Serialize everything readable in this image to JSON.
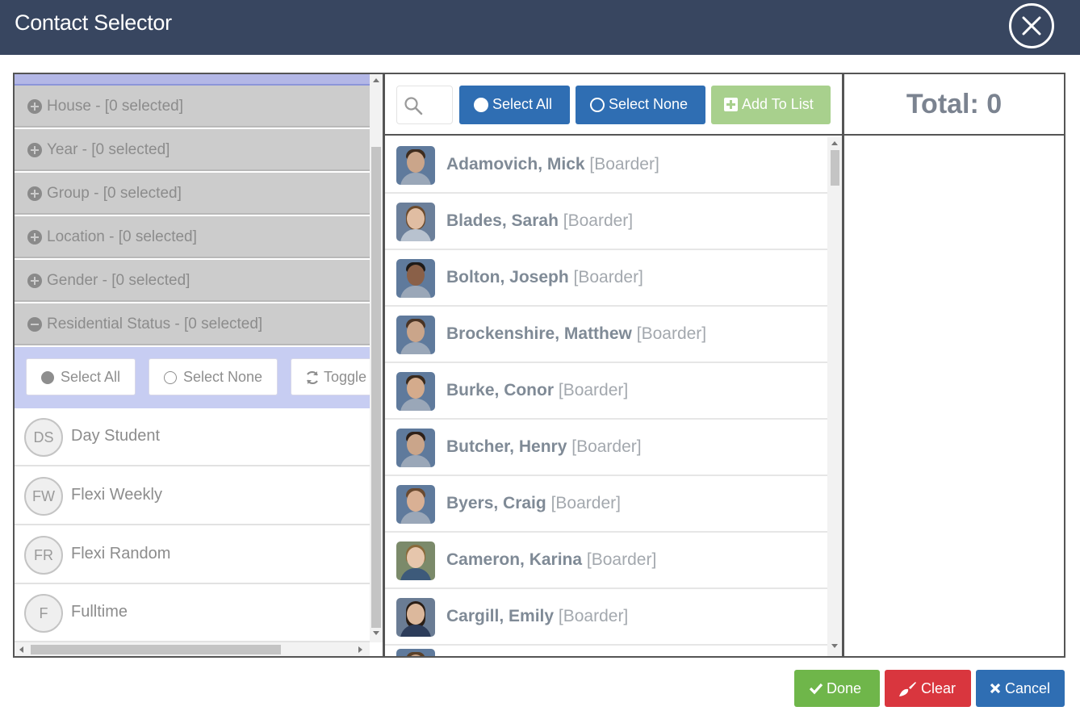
{
  "window": {
    "title": "Contact Selector"
  },
  "categories": [
    {
      "label": "House - [0 selected]",
      "expanded": false
    },
    {
      "label": "Year - [0 selected]",
      "expanded": false
    },
    {
      "label": "Group - [0 selected]",
      "expanded": false
    },
    {
      "label": "Location - [0 selected]",
      "expanded": false
    },
    {
      "label": "Gender - [0 selected]",
      "expanded": false
    },
    {
      "label": "Residential Status - [0 selected]",
      "expanded": true
    }
  ],
  "status_options": {
    "select_all_label": "Select All",
    "select_none_label": "Select None",
    "toggle_label": "Toggle",
    "items": [
      {
        "initials": "DS",
        "label": "Day Student"
      },
      {
        "initials": "FW",
        "label": "Flexi Weekly"
      },
      {
        "initials": "FR",
        "label": "Flexi Random"
      },
      {
        "initials": "F",
        "label": "Fulltime"
      }
    ]
  },
  "toolbar": {
    "select_all_label": "Select All",
    "select_none_label": "Select None",
    "add_to_list_label": "Add To List"
  },
  "contacts": [
    {
      "name": "Adamovich, Mick",
      "tag": "[Boarder]"
    },
    {
      "name": "Blades, Sarah",
      "tag": "[Boarder]"
    },
    {
      "name": "Bolton, Joseph",
      "tag": "[Boarder]"
    },
    {
      "name": "Brockenshire, Matthew",
      "tag": "[Boarder]"
    },
    {
      "name": "Burke, Conor",
      "tag": "[Boarder]"
    },
    {
      "name": "Butcher, Henry",
      "tag": "[Boarder]"
    },
    {
      "name": "Byers, Craig",
      "tag": "[Boarder]"
    },
    {
      "name": "Cameron, Karina",
      "tag": "[Boarder]"
    },
    {
      "name": "Cargill, Emily",
      "tag": "[Boarder]"
    }
  ],
  "selection": {
    "total_label": "Total: 0"
  },
  "footer": {
    "done_label": "Done",
    "clear_label": "Clear",
    "cancel_label": "Cancel"
  },
  "colors": {
    "title_bar": "#384660",
    "primary_blue": "#2f6eb3",
    "add_green": "#a8d08d",
    "done_green": "#6fb64a",
    "clear_red": "#d9363e",
    "cancel_blue": "#2f6eb3",
    "expanded_panel": "#c7cdf2"
  }
}
